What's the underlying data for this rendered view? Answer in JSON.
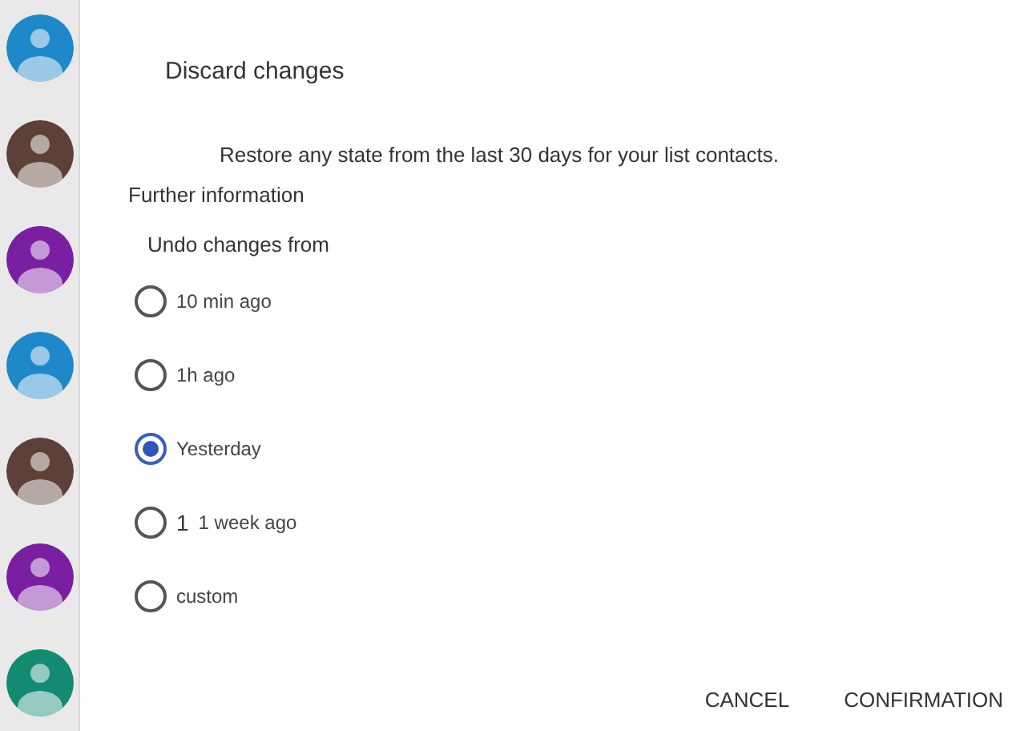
{
  "sidebar": {
    "avatars": [
      {
        "color": "#1e88c8"
      },
      {
        "color": "#5d4037"
      },
      {
        "color": "#7b1fa2"
      },
      {
        "color": "#1e88c8"
      },
      {
        "color": "#5d4037"
      },
      {
        "color": "#7b1fa2"
      },
      {
        "color": "#138a72"
      }
    ]
  },
  "dialog": {
    "title": "Discard changes",
    "description": "Restore any state from the last 30 days for your list contacts. Further information",
    "group_label": "Undo changes from",
    "options": [
      {
        "label": "10 min ago",
        "selected": false
      },
      {
        "label": "1h ago",
        "selected": false
      },
      {
        "label": "Yesterday",
        "selected": true
      },
      {
        "prefix": "1",
        "label": "1 week ago",
        "selected": false
      },
      {
        "label": "custom",
        "selected": false
      }
    ],
    "buttons": [
      "CANCEL",
      "CONFIRMATION"
    ]
  }
}
